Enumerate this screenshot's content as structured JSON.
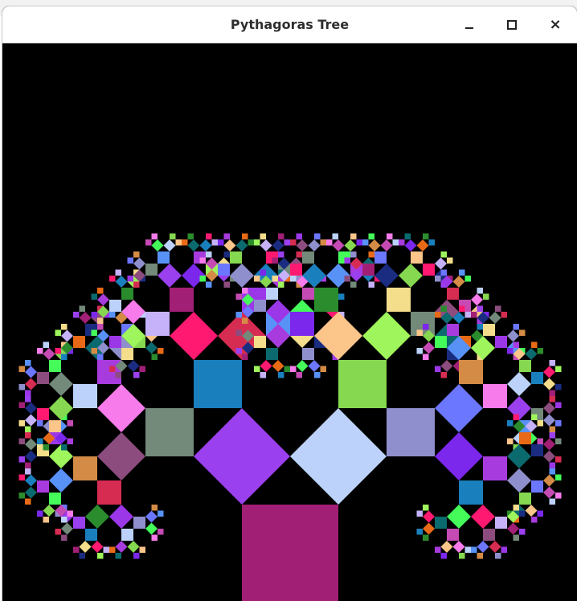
{
  "window": {
    "title": "Pythagoras Tree",
    "controls": {
      "minimize_icon": "minimize-icon",
      "maximize_icon": "maximize-icon",
      "close_icon": "close-icon",
      "close_glyph": "×"
    }
  },
  "canvas": {
    "background": "#000000",
    "palette": [
      "#a21f76",
      "#9b40ee",
      "#73897a",
      "#8c4c7e",
      "#d72c52",
      "#9c37e8",
      "#8f8fcd",
      "#6c77ff",
      "#d48b45",
      "#5992f7",
      "#44fb5a",
      "#c54ab4",
      "#f77bea",
      "#bcd2fb",
      "#86d850",
      "#fcc58a",
      "#7b27ec",
      "#a83bde",
      "#0b6a6e",
      "#e86a16",
      "#2b8c2e",
      "#1a7fbd",
      "#ff1971",
      "#c5b2f9",
      "#9ef55c",
      "#f4dd8b",
      "#1a2c80"
    ]
  }
}
